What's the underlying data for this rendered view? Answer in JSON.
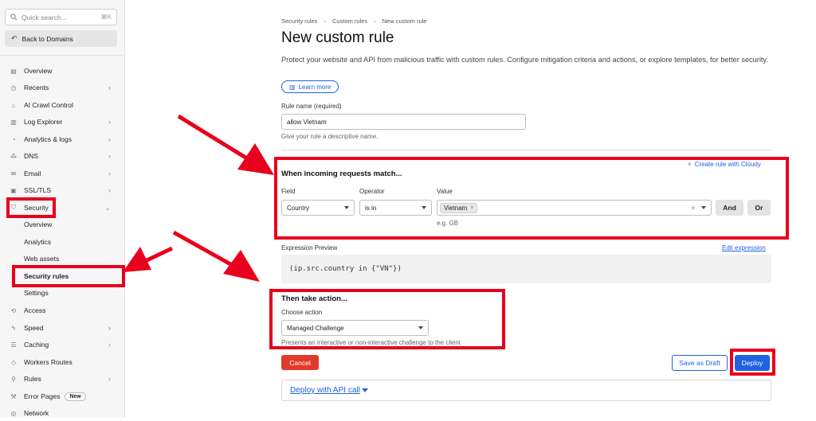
{
  "sidebar": {
    "search": {
      "placeholder": "Quick search...",
      "shortcut": "⌘K"
    },
    "back_label": "Back to Domains",
    "items": [
      {
        "label": "Overview",
        "icon": "document-icon"
      },
      {
        "label": "Recents",
        "icon": "clock-icon",
        "chevron": true
      },
      {
        "label": "AI Crawl Control",
        "icon": "robot-icon"
      },
      {
        "label": "Log Explorer",
        "icon": "log-icon",
        "chevron": true
      },
      {
        "label": "Analytics & logs",
        "icon": "chart-icon",
        "chevron": true
      },
      {
        "label": "DNS",
        "icon": "network-icon",
        "chevron": true
      },
      {
        "label": "Email",
        "icon": "envelope-icon",
        "chevron": true
      },
      {
        "label": "SSL/TLS",
        "icon": "lock-icon",
        "chevron": true
      },
      {
        "label": "Security",
        "icon": "shield-icon",
        "chevron": true,
        "expanded": true
      }
    ],
    "security_sub": [
      "Overview",
      "Analytics",
      "Web assets",
      "Security rules",
      "Settings"
    ],
    "items_after": [
      {
        "label": "Access",
        "icon": "arrow-circle-icon"
      },
      {
        "label": "Speed",
        "icon": "bolt-icon",
        "chevron": true
      },
      {
        "label": "Caching",
        "icon": "database-icon",
        "chevron": true
      },
      {
        "label": "Workers Routes",
        "icon": "workers-icon"
      },
      {
        "label": "Rules",
        "icon": "rules-icon",
        "chevron": true
      },
      {
        "label": "Error Pages",
        "icon": "wrench-icon",
        "badge": "New"
      },
      {
        "label": "Network",
        "icon": "pin-icon"
      }
    ]
  },
  "breadcrumbs": [
    "Security rules",
    "Custom rules",
    "New custom rule"
  ],
  "title": "New custom rule",
  "description": "Protect your website and API from malicious traffic with custom rules. Configure mitigation criteria and actions, or explore templates, for better security.",
  "learn_more": "Learn more",
  "rule_name": {
    "label": "Rule name (required)",
    "value": "allow Vietnam",
    "hint": "Give your rule a descriptive name."
  },
  "match": {
    "title": "When incoming requests match...",
    "cloudy_link": "Create rule with Cloudy",
    "field_label": "Field",
    "operator_label": "Operator",
    "value_label": "Value",
    "field_value": "Country",
    "operator_value": "is in",
    "value_tag": "Vietnam",
    "value_hint": "e.g. GB",
    "and_label": "And",
    "or_label": "Or"
  },
  "expression": {
    "label": "Expression Preview",
    "edit_link": "Edit expression",
    "code": "(ip.src.country in {\"VN\"})"
  },
  "action": {
    "title": "Then take action...",
    "choose_label": "Choose action",
    "selected": "Managed Challenge",
    "hint": "Presents an interactive or non-interactive challenge to the client"
  },
  "buttons": {
    "cancel": "Cancel",
    "save_draft": "Save as Draft",
    "deploy": "Deploy",
    "deploy_api": "Deploy with API call"
  },
  "colors": {
    "annotation_red": "#e8001c",
    "primary_blue": "#1f63e0",
    "cancel_red": "#e03a2a"
  }
}
